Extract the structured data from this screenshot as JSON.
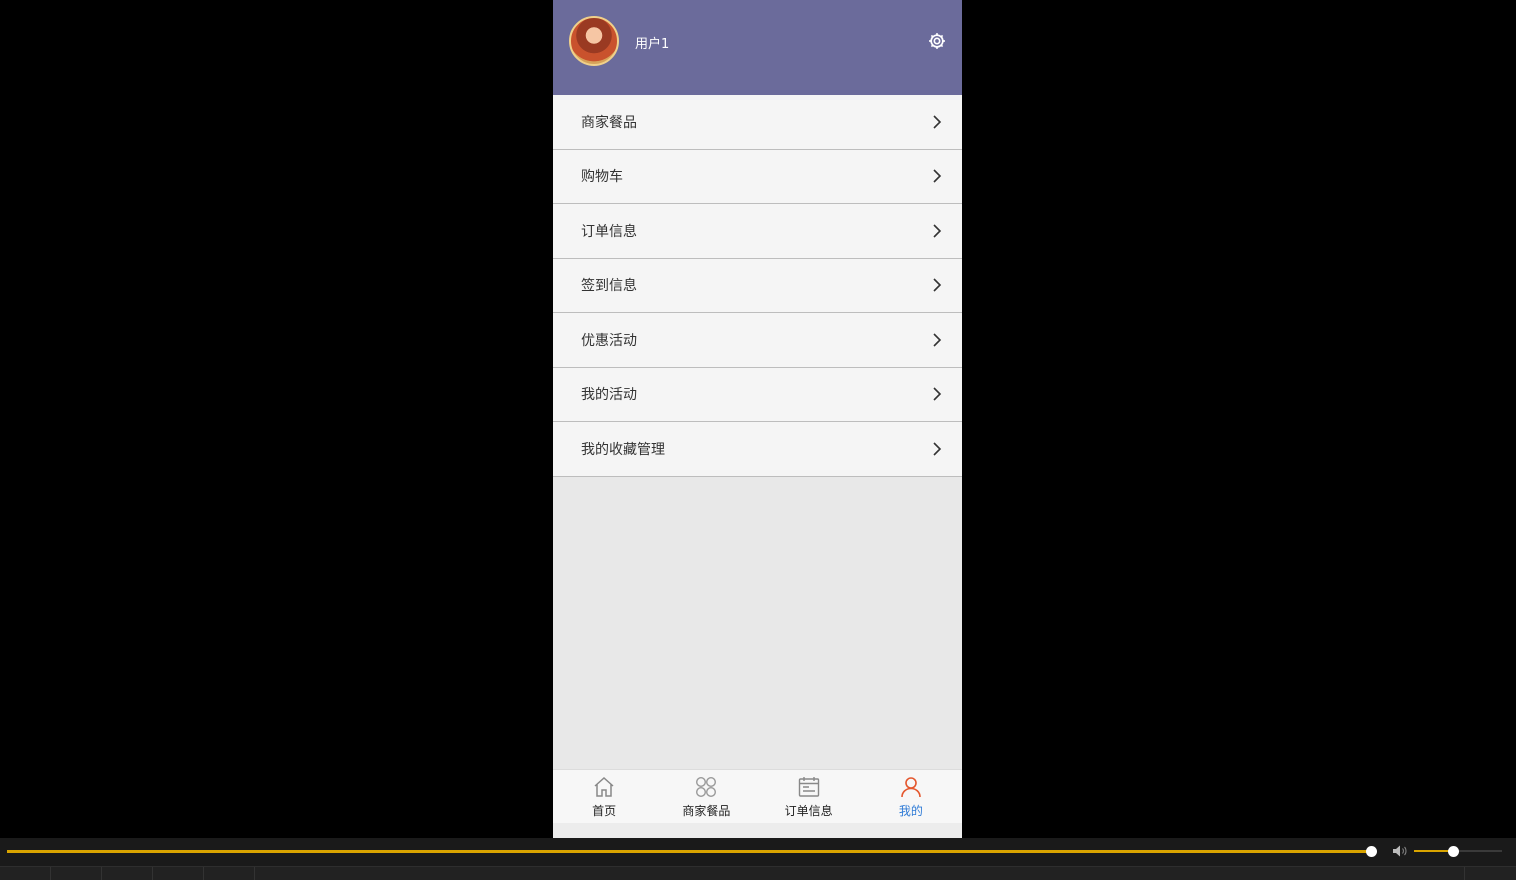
{
  "profile": {
    "username": "用户1",
    "header_color": "#6b6b9b"
  },
  "menu": {
    "items": [
      {
        "label": "商家餐品"
      },
      {
        "label": "购物车"
      },
      {
        "label": "订单信息"
      },
      {
        "label": "签到信息"
      },
      {
        "label": "优惠活动"
      },
      {
        "label": "我的活动"
      },
      {
        "label": "我的收藏管理"
      }
    ]
  },
  "tabbar": {
    "tabs": [
      {
        "label": "首页",
        "icon": "home-icon"
      },
      {
        "label": "商家餐品",
        "icon": "grid-icon"
      },
      {
        "label": "订单信息",
        "icon": "calendar-icon"
      },
      {
        "label": "我的",
        "icon": "user-icon",
        "active": true
      }
    ],
    "active_color": "#2f7bd6"
  },
  "player": {
    "progress": 0.997,
    "volume": 0.45,
    "accent_color": "#d9a400"
  }
}
